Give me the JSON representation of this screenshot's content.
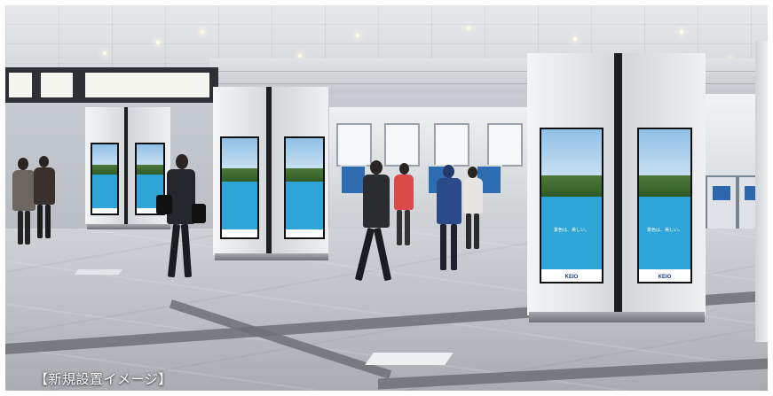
{
  "scene": {
    "caption": "【新規設置イメージ】",
    "kiosks": [
      {
        "id": "far-left",
        "screens": 2
      },
      {
        "id": "center",
        "screens": 2
      },
      {
        "id": "right-large",
        "screens": 2
      }
    ],
    "screen_content": {
      "logo": "KEIO",
      "message": "景色は、美しい。"
    },
    "colors": {
      "sky": "#8fbfe6",
      "mountain": "#3e6d31",
      "lake": "#2fa4d6",
      "kiosk_panel": "#e4e6e8",
      "floor": "#bcbfc4"
    }
  }
}
